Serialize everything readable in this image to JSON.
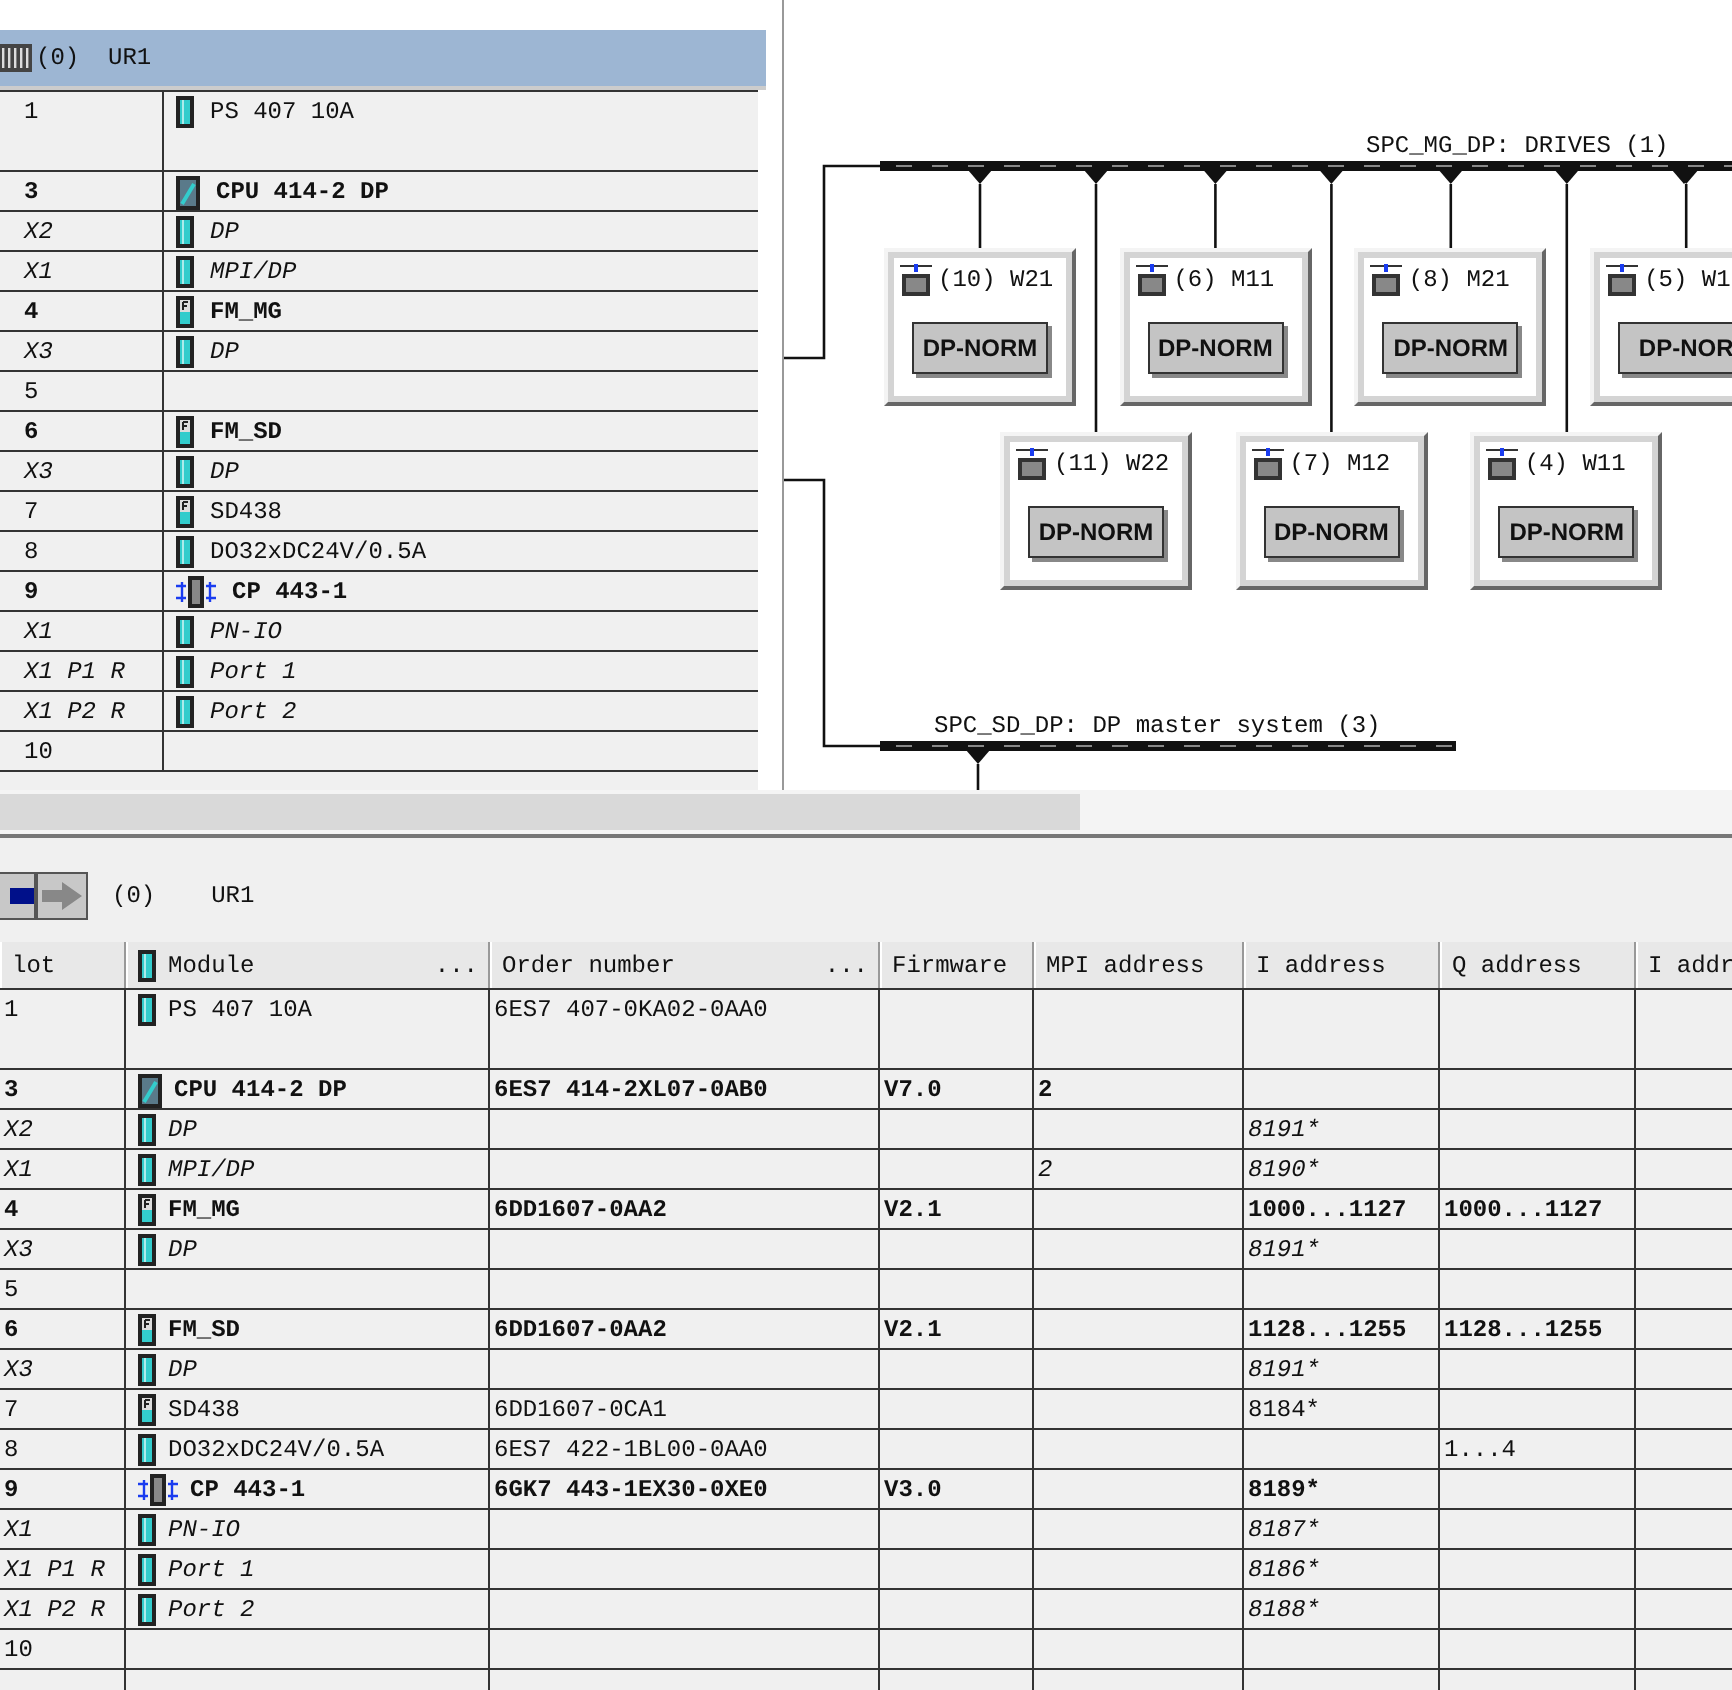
{
  "rack": {
    "title": "(0)  UR1",
    "rows": [
      {
        "slot": "1",
        "module": "PS 407 10A",
        "kind": "module",
        "bold": false,
        "italic": false,
        "tall": true
      },
      {
        "slot": "3",
        "module": "CPU 414-2 DP",
        "kind": "cpu",
        "bold": true,
        "italic": false,
        "tall": false
      },
      {
        "slot": "X2",
        "module": "DP",
        "kind": "module",
        "bold": false,
        "italic": true,
        "tall": false
      },
      {
        "slot": "X1",
        "module": "MPI/DP",
        "kind": "module",
        "bold": false,
        "italic": true,
        "tall": false
      },
      {
        "slot": "4",
        "module": "FM_MG",
        "kind": "fm",
        "bold": true,
        "italic": false,
        "tall": false
      },
      {
        "slot": "X3",
        "module": "DP",
        "kind": "module",
        "bold": false,
        "italic": true,
        "tall": false
      },
      {
        "slot": "5",
        "kind": "empty",
        "bold": false,
        "italic": false,
        "tall": false
      },
      {
        "slot": "6",
        "module": "FM_SD",
        "kind": "fm",
        "bold": true,
        "italic": false,
        "tall": false
      },
      {
        "slot": "X3",
        "module": "DP",
        "kind": "module",
        "bold": false,
        "italic": true,
        "tall": false
      },
      {
        "slot": "7",
        "module": "SD438",
        "kind": "fm",
        "bold": false,
        "italic": false,
        "tall": false
      },
      {
        "slot": "8",
        "module": "DO32xDC24V/0.5A",
        "kind": "module",
        "bold": false,
        "italic": false,
        "tall": false
      },
      {
        "slot": "9",
        "module": "CP 443-1",
        "kind": "cp",
        "bold": true,
        "italic": false,
        "tall": false
      },
      {
        "slot": "X1",
        "module": "PN-IO",
        "kind": "module",
        "bold": false,
        "italic": true,
        "tall": false
      },
      {
        "slot": "X1 P1 R",
        "module": "Port 1",
        "kind": "module",
        "bold": false,
        "italic": true,
        "tall": false
      },
      {
        "slot": "X1 P2 R",
        "module": "Port 2",
        "kind": "module",
        "bold": false,
        "italic": true,
        "tall": false
      },
      {
        "slot": "10",
        "kind": "empty",
        "bold": false,
        "italic": false,
        "tall": false
      }
    ]
  },
  "network": {
    "buses": [
      {
        "label": "SPC_MG_DP: DRIVES (1)",
        "kind": "drives"
      },
      {
        "label": "SPC_SD_DP: DP master system (3)",
        "kind": "master"
      }
    ],
    "upper_row": [
      {
        "label": "(10) W21",
        "status": "DP-NORM"
      },
      {
        "label": "(6) M11",
        "status": "DP-NORM"
      },
      {
        "label": "(8) M21",
        "status": "DP-NORM"
      },
      {
        "label": "(5) W1",
        "status": "DP-NOR"
      }
    ],
    "lower_row": [
      {
        "label": "(11) W22",
        "status": "DP-NORM"
      },
      {
        "label": "(7) M12",
        "status": "DP-NORM"
      },
      {
        "label": "(4) W11",
        "status": "DP-NORM"
      }
    ]
  },
  "detail": {
    "rack_number": "(0)",
    "rack_name": "UR1",
    "columns": [
      {
        "label": "lot"
      },
      {
        "label": "Module",
        "menu": "..."
      },
      {
        "label": "Order number",
        "menu": "..."
      },
      {
        "label": "Firmware"
      },
      {
        "label": "MPI address"
      },
      {
        "label": "I address"
      },
      {
        "label": "Q address"
      },
      {
        "label": "I addr"
      }
    ],
    "rows": [
      {
        "slot": "1",
        "module": "PS 407 10A",
        "order_number": "6ES7 407-0KA02-0AA0",
        "kind": "module",
        "bold": false,
        "italic": false,
        "tall": true
      },
      {
        "slot": "3",
        "module": "CPU 414-2 DP",
        "order_number": "6ES7 414-2XL07-0AB0",
        "firmware": "V7.0",
        "mpi_address": "2",
        "kind": "cpu",
        "bold": true,
        "italic": false,
        "tall": false
      },
      {
        "slot": "X2",
        "module": "DP",
        "i_address": "8191*",
        "kind": "module",
        "bold": false,
        "italic": true,
        "tall": false
      },
      {
        "slot": "X1",
        "module": "MPI/DP",
        "mpi_address": "2",
        "i_address": "8190*",
        "kind": "module",
        "bold": false,
        "italic": true,
        "tall": false
      },
      {
        "slot": "4",
        "module": "FM_MG",
        "order_number": "6DD1607-0AA2",
        "firmware": "V2.1",
        "i_address": "1000...1127",
        "q_address": "1000...1127",
        "kind": "fm",
        "bold": true,
        "italic": false,
        "tall": false
      },
      {
        "slot": "X3",
        "module": "DP",
        "i_address": "8191*",
        "kind": "module",
        "bold": false,
        "italic": true,
        "tall": false
      },
      {
        "slot": "5",
        "kind": "empty",
        "bold": false,
        "italic": false,
        "tall": false
      },
      {
        "slot": "6",
        "module": "FM_SD",
        "order_number": "6DD1607-0AA2",
        "firmware": "V2.1",
        "i_address": "1128...1255",
        "q_address": "1128...1255",
        "kind": "fm",
        "bold": true,
        "italic": false,
        "tall": false
      },
      {
        "slot": "X3",
        "module": "DP",
        "i_address": "8191*",
        "kind": "module",
        "bold": false,
        "italic": true,
        "tall": false
      },
      {
        "slot": "7",
        "module": "SD438",
        "order_number": "6DD1607-0CA1",
        "i_address": "8184*",
        "kind": "fm",
        "bold": false,
        "italic": false,
        "tall": false
      },
      {
        "slot": "8",
        "module": "DO32xDC24V/0.5A",
        "order_number": "6ES7 422-1BL00-0AA0",
        "q_address": "1...4",
        "kind": "module",
        "bold": false,
        "italic": false,
        "tall": false
      },
      {
        "slot": "9",
        "module": "CP 443-1",
        "order_number": "6GK7 443-1EX30-0XE0",
        "firmware": "V3.0",
        "i_address": "8189*",
        "kind": "cp",
        "bold": true,
        "italic": false,
        "tall": false
      },
      {
        "slot": "X1",
        "module": "PN-IO",
        "i_address": "8187*",
        "kind": "module",
        "bold": false,
        "italic": true,
        "tall": false
      },
      {
        "slot": "X1 P1 R",
        "module": "Port 1",
        "i_address": "8186*",
        "kind": "module",
        "bold": false,
        "italic": true,
        "tall": false
      },
      {
        "slot": "X1 P2 R",
        "module": "Port 2",
        "i_address": "8188*",
        "kind": "module",
        "bold": false,
        "italic": true,
        "tall": false
      },
      {
        "slot": "10",
        "kind": "empty",
        "bold": false,
        "italic": false,
        "tall": false
      }
    ]
  }
}
